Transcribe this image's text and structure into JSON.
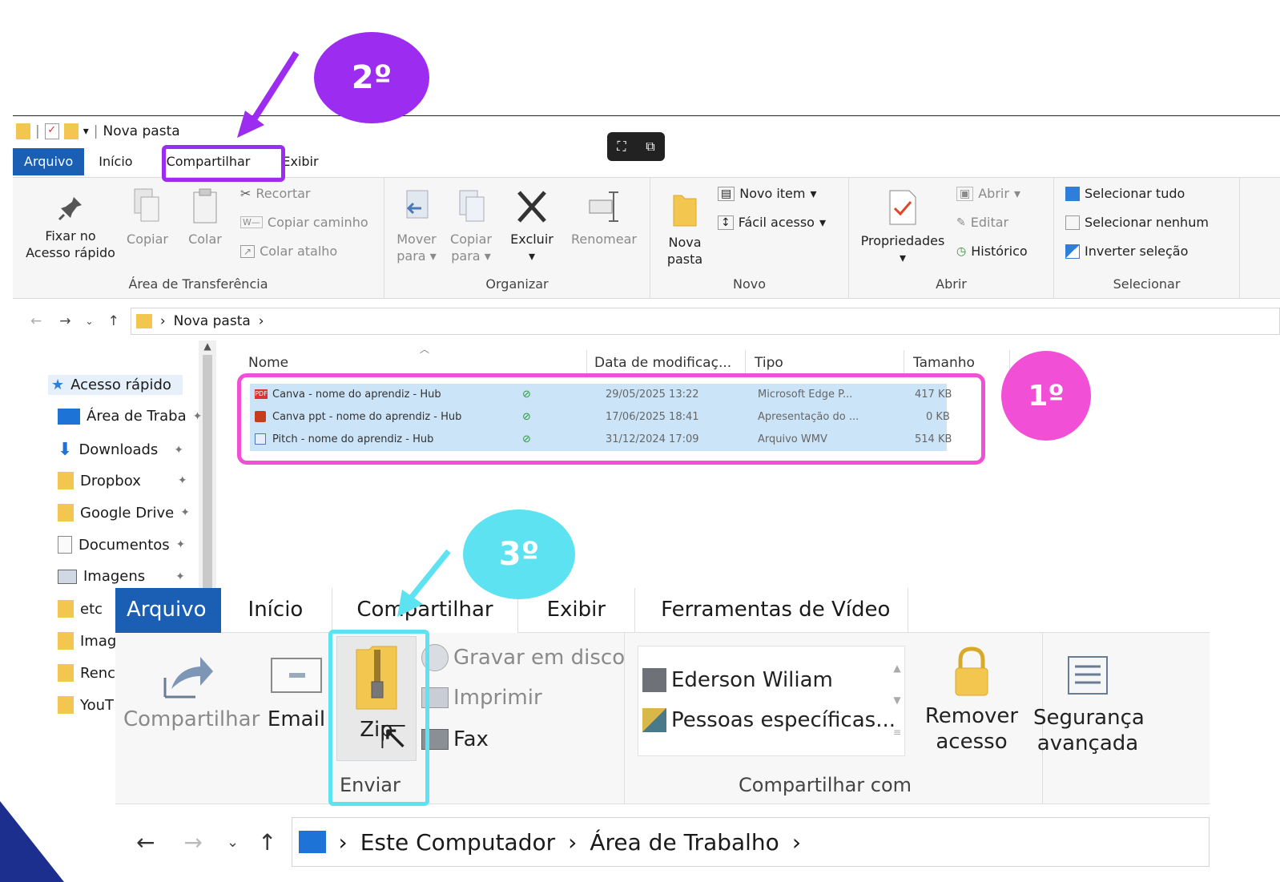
{
  "window1": {
    "title": "Nova pasta",
    "tabs": [
      "Arquivo",
      "Início",
      "Compartilhar",
      "Exibir"
    ],
    "ribbon": {
      "pin_label_1": "Fixar no",
      "pin_label_2": "Acesso rápido",
      "copy_label": "Copiar",
      "paste_label": "Colar",
      "cut_label": "Recortar",
      "copy_path_label": "Copiar caminho",
      "paste_shortcut_label": "Colar atalho",
      "clipboard_group": "Área de Transferência",
      "move_label_1": "Mover",
      "move_label_2": "para",
      "copyto_label_1": "Copiar",
      "copyto_label_2": "para",
      "delete_label": "Excluir",
      "rename_label": "Renomear",
      "organize_group": "Organizar",
      "newfolder_label_1": "Nova",
      "newfolder_label_2": "pasta",
      "newitem_label": "Novo item",
      "easyaccess_label": "Fácil acesso",
      "new_group": "Novo",
      "properties_label": "Propriedades",
      "open_label": "Abrir",
      "edit_label": "Editar",
      "history_label": "Histórico",
      "open_group": "Abrir",
      "selectall_label": "Selecionar tudo",
      "selectnone_label": "Selecionar nenhum",
      "invert_label": "Inverter seleção",
      "select_group": "Selecionar"
    },
    "address": {
      "path": "Nova pasta"
    },
    "nav": [
      {
        "label": "Acesso rápido"
      },
      {
        "label": "Área de Traba"
      },
      {
        "label": "Downloads"
      },
      {
        "label": "Dropbox"
      },
      {
        "label": "Google Drive"
      },
      {
        "label": "Documentos"
      },
      {
        "label": "Imagens"
      },
      {
        "label": "etc"
      },
      {
        "label": "Imag"
      },
      {
        "label": "Renc"
      },
      {
        "label": "YouT"
      }
    ],
    "columns": {
      "name": "Nome",
      "date": "Data de modificaç...",
      "type": "Tipo",
      "size": "Tamanho"
    },
    "files": [
      {
        "name": "Canva - nome do aprendiz - Hub",
        "date": "29/05/2025 13:22",
        "type": "Microsoft Edge P...",
        "size": "417 KB"
      },
      {
        "name": "Canva ppt - nome do aprendiz - Hub",
        "date": "17/06/2025 18:41",
        "type": "Apresentação do ...",
        "size": "0 KB"
      },
      {
        "name": "Pitch - nome do aprendiz - Hub",
        "date": "31/12/2024 17:09",
        "type": "Arquivo WMV",
        "size": "514 KB"
      }
    ]
  },
  "window2": {
    "tabs": [
      "Arquivo",
      "Início",
      "Compartilhar",
      "Exibir",
      "Ferramentas de Vídeo"
    ],
    "share_label": "Compartilhar",
    "email_label": "Email",
    "zip_label": "Zip",
    "burn_label": "Gravar em disco",
    "print_label": "Imprimir",
    "fax_label": "Fax",
    "send_group": "Enviar",
    "contacts": [
      "Ederson Wiliam",
      "Pessoas específicas..."
    ],
    "remove_label_1": "Remover",
    "remove_label_2": "acesso",
    "security_label_1": "Segurança",
    "security_label_2": "avançada",
    "sharewith_group": "Compartilhar com",
    "address": [
      "Este Computador",
      "Área de Trabalho"
    ]
  },
  "annotations": {
    "step1": "1º",
    "step2": "2º",
    "step3": "3º",
    "colors": {
      "step1": "#f04fd6",
      "step2": "#9b2cf0",
      "step3": "#5ce2f0"
    }
  }
}
